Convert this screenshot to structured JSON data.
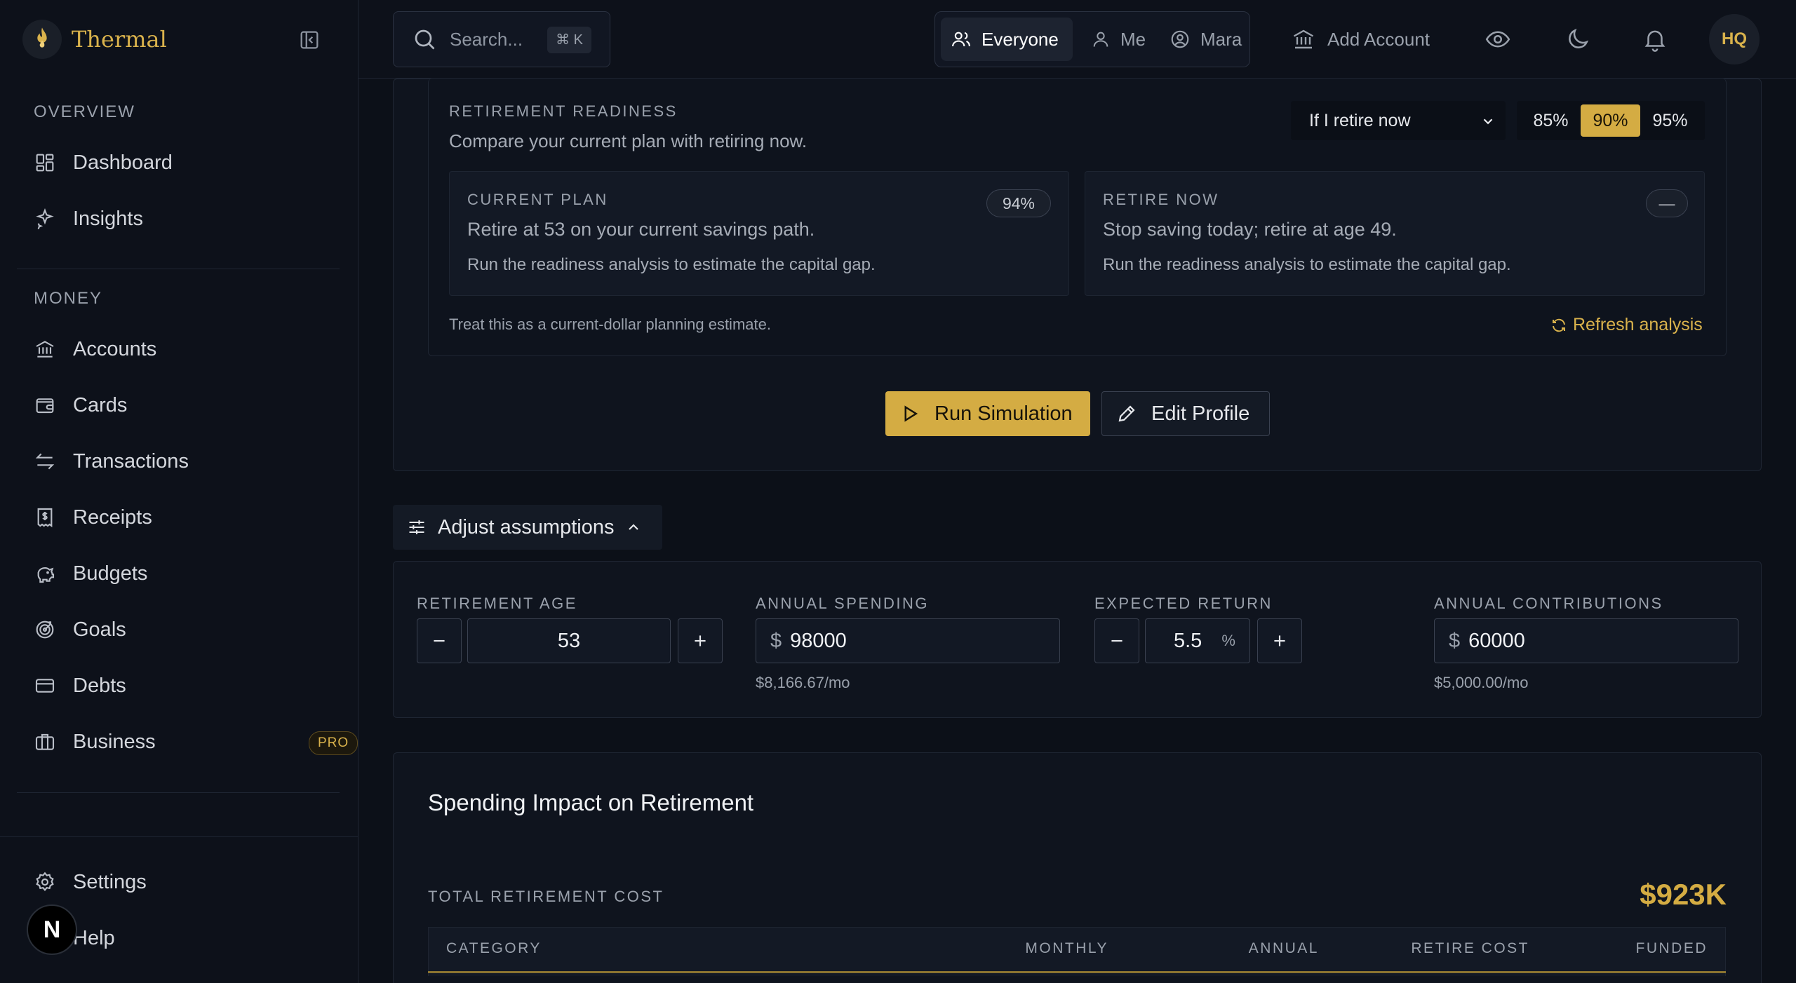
{
  "app": {
    "name": "Thermal"
  },
  "sidebar": {
    "sections": [
      {
        "title": "OVERVIEW",
        "items": [
          {
            "label": "Dashboard",
            "icon": "dashboard-icon"
          },
          {
            "label": "Insights",
            "icon": "sparkles-icon"
          }
        ]
      },
      {
        "title": "MONEY",
        "items": [
          {
            "label": "Accounts",
            "icon": "bank-icon"
          },
          {
            "label": "Cards",
            "icon": "wallet-icon"
          },
          {
            "label": "Transactions",
            "icon": "arrows-icon"
          },
          {
            "label": "Receipts",
            "icon": "receipt-icon"
          },
          {
            "label": "Budgets",
            "icon": "piggy-bank-icon"
          },
          {
            "label": "Goals",
            "icon": "target-icon"
          },
          {
            "label": "Debts",
            "icon": "credit-card-icon"
          },
          {
            "label": "Business",
            "icon": "briefcase-icon",
            "badge": "PRO"
          }
        ]
      }
    ],
    "footer": [
      {
        "label": "Settings",
        "icon": "gear-icon"
      },
      {
        "label": "Help",
        "icon": "help-icon"
      }
    ],
    "avatar_letter": "N"
  },
  "topbar": {
    "search_placeholder": "Search...",
    "search_shortcut": "⌘ K",
    "scope": [
      {
        "label": "Everyone",
        "active": true
      },
      {
        "label": "Me"
      },
      {
        "label": "Mara"
      }
    ],
    "add_account": "Add Account",
    "user_initials": "HQ"
  },
  "readiness": {
    "title": "RETIREMENT READINESS",
    "subtitle": "Compare your current plan with retiring now.",
    "scenario_select": "If I retire now",
    "confidence_options": [
      "85%",
      "90%",
      "95%"
    ],
    "confidence_selected": "90%",
    "current_plan": {
      "title": "CURRENT PLAN",
      "badge": "94%",
      "description": "Retire at 53 on your current savings path.",
      "note": "Run the readiness analysis to estimate the capital gap."
    },
    "retire_now": {
      "title": "RETIRE NOW",
      "badge": "—",
      "description": "Stop saving today; retire at age 49.",
      "note": "Run the readiness analysis to estimate the capital gap."
    },
    "footnote": "Treat this as a current-dollar planning estimate.",
    "refresh_label": "Refresh analysis"
  },
  "actions": {
    "run_simulation": "Run Simulation",
    "edit_profile": "Edit Profile"
  },
  "assumptions": {
    "toggle_label": "Adjust assumptions",
    "retirement_age": {
      "label": "RETIREMENT AGE",
      "value": "53"
    },
    "annual_spending": {
      "label": "ANNUAL SPENDING",
      "prefix": "$",
      "value": "98000",
      "note": "$8,166.67/mo"
    },
    "expected_return": {
      "label": "EXPECTED RETURN",
      "value": "5.5",
      "suffix": "%"
    },
    "annual_contributions": {
      "label": "ANNUAL CONTRIBUTIONS",
      "prefix": "$",
      "value": "60000",
      "note": "$5,000.00/mo"
    }
  },
  "spending_impact": {
    "title": "Spending Impact on Retirement",
    "total_label": "TOTAL RETIREMENT COST",
    "total_value": "$923K",
    "columns": [
      "CATEGORY",
      "MONTHLY",
      "ANNUAL",
      "RETIRE COST",
      "FUNDED"
    ]
  },
  "colors": {
    "accent": "#d4ac43",
    "background": "#0c1018",
    "panel": "#0f141e"
  }
}
